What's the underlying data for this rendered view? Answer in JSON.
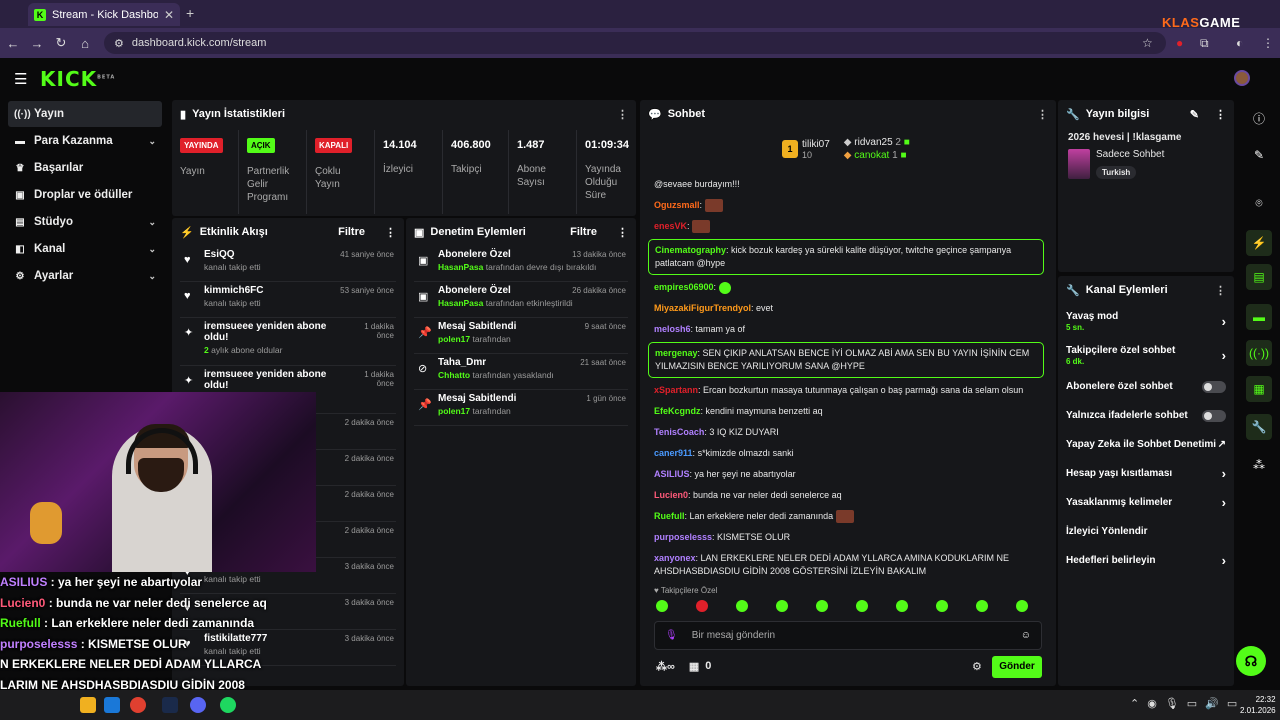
{
  "browser": {
    "tab_title": "Stream - Kick Dashboard",
    "url": "dashboard.kick.com/stream",
    "brand_left": "KLAS",
    "brand_right": "GAME"
  },
  "header": {
    "logo": "KICK",
    "logo_sup": "BETA"
  },
  "sidebar": {
    "items": [
      {
        "label": "Yayın",
        "icon": "stream-icon",
        "active": true
      },
      {
        "label": "Para Kazanma",
        "icon": "money-icon",
        "expand": true
      },
      {
        "label": "Başarılar",
        "icon": "trophy-icon"
      },
      {
        "label": "Droplar ve ödüller",
        "icon": "gift-icon"
      },
      {
        "label": "Stüdyo",
        "icon": "studio-icon",
        "expand": true
      },
      {
        "label": "Kanal",
        "icon": "channel-icon",
        "expand": true
      },
      {
        "label": "Ayarlar",
        "icon": "gear-icon",
        "expand": true
      }
    ]
  },
  "stats": {
    "title": "Yayın İstatistikleri",
    "cols": [
      {
        "badge": "YAYINDA",
        "badge_color": "#e0202a",
        "label": "Yayın"
      },
      {
        "badge": "AÇIK",
        "badge_color": "#53fc18",
        "label": "Partnerlik Gelir Programı"
      },
      {
        "badge": "KAPALI",
        "badge_color": "#e0202a",
        "label": "Çoklu Yayın"
      },
      {
        "value": "14.104",
        "label": "İzleyici"
      },
      {
        "value": "406.800",
        "label": "Takipçi"
      },
      {
        "value": "1.487",
        "label": "Abone Sayısı"
      },
      {
        "value": "01:09:34",
        "label": "Yayında Olduğu Süre"
      }
    ]
  },
  "activity": {
    "title": "Etkinlik Akışı",
    "filter": "Filtre",
    "items": [
      {
        "name": "EsiQQ",
        "sub": "kanalı takip etti",
        "time": "41 saniye önce",
        "icon": "heart-icon"
      },
      {
        "name": "kimmich6FC",
        "sub": "kanalı takip etti",
        "time": "53 saniye önce",
        "icon": "heart-icon"
      },
      {
        "name": "iremsueee yeniden abone oldu!",
        "sub_green": "2",
        "sub": "aylık abone oldular",
        "time": "1 dakika önce",
        "icon": "sparkle-icon"
      },
      {
        "name": "iremsueee yeniden abone oldu!",
        "sub": "",
        "time": "1 dakika önce",
        "icon": "sparkle-icon"
      },
      {
        "name": "",
        "sub": "",
        "time": "2 dakika önce",
        "icon": ""
      },
      {
        "name": "",
        "sub": "",
        "time": "2 dakika önce",
        "icon": ""
      },
      {
        "name": "",
        "sub": "",
        "time": "2 dakika önce",
        "icon": ""
      },
      {
        "name": "",
        "sub": "",
        "time": "2 dakika önce",
        "icon": ""
      },
      {
        "name": "memofirarda",
        "sub": "kanalı takip etti",
        "time": "3 dakika önce",
        "icon": "heart-icon"
      },
      {
        "name": "",
        "sub": "",
        "time": "3 dakika önce",
        "icon": "heart-icon"
      },
      {
        "name": "fistikilatte777",
        "sub": "kanalı takip etti",
        "time": "3 dakika önce",
        "icon": "heart-icon"
      }
    ]
  },
  "moderation": {
    "title": "Denetim Eylemleri",
    "filter": "Filtre",
    "items": [
      {
        "name": "Abonelere Özel",
        "green": "HasanPasa",
        "sub": "tarafından devre dışı bırakıldı",
        "time": "13 dakika önce",
        "icon": "gift-icon"
      },
      {
        "name": "Abonelere Özel",
        "green": "HasanPasa",
        "sub": "tarafından etkinleştirildi",
        "time": "26 dakika önce",
        "icon": "gift-icon"
      },
      {
        "name": "Mesaj Sabitlendi",
        "green": "polen17",
        "sub": "tarafından",
        "time": "9 saat önce",
        "icon": "pin-icon"
      },
      {
        "name": "Taha_Dmr",
        "green": "Chhatto",
        "sub": "tarafından yasaklandı",
        "time": "21 saat önce",
        "icon": "ban-icon"
      },
      {
        "name": "Mesaj Sabitlendi",
        "green": "polen17",
        "sub": "tarafından",
        "time": "1 gün önce",
        "icon": "pin-icon"
      }
    ]
  },
  "chat": {
    "title": "Sohbet",
    "top": [
      {
        "rank": "1",
        "name": "tiliki07",
        "count": "10"
      },
      {
        "name": "ridvan25",
        "count": "2"
      },
      {
        "name": "canokat",
        "count": "1"
      }
    ],
    "messages": [
      {
        "user": "",
        "color": "#53fc18",
        "text": "@sevaee burdayım!!!",
        "emote": false
      },
      {
        "user": "Oguzsmall",
        "color": "#ff6a1a",
        "text": "",
        "emote": true
      },
      {
        "user": "enesVK",
        "color": "#e0202a",
        "text": "",
        "emote": true
      },
      {
        "user": "Cinematography",
        "color": "#53fc18",
        "text": "kick bozuk kardeş ya sürekli kalite düşüyor, twitche geçince şampanya patlatcam @hype",
        "hl": true
      },
      {
        "user": "empires06900",
        "color": "#53fc18",
        "text": "",
        "gemote": true
      },
      {
        "user": "MiyazakiFigurTrendyol",
        "color": "#ff9a1a",
        "text": "evet"
      },
      {
        "user": "melosh6",
        "color": "#b080ff",
        "text": "tamam ya of"
      },
      {
        "user": "mergenay",
        "color": "#53fc18",
        "text": "SEN ÇIKIP ANLATSAN BENCE İYİ OLMAZ ABİ AMA SEN BU YAYIN İŞİNİN CEM YILMAZISIN BENCE YARILIYORUM SANA @HYPE",
        "hl": true
      },
      {
        "user": "xSpartann",
        "color": "#e0202a",
        "text": "Ercan bozkurtun masaya tutunmaya çalışan o baş parmağı sana da selam olsun"
      },
      {
        "user": "EfeKcgndz",
        "color": "#53fc18",
        "text": "kendini maymuna benzetti aq"
      },
      {
        "user": "TenisCoach",
        "color": "#b080ff",
        "text": "3 IQ KIZ DUYARI"
      },
      {
        "user": "caner911",
        "color": "#4a9aff",
        "text": "s*kimizde olmazdı sanki"
      },
      {
        "user": "ASILIUS",
        "color": "#b080ff",
        "text": "ya her şeyi ne abartıyolar"
      },
      {
        "user": "Lucien0",
        "color": "#ff5a7a",
        "text": "bunda ne var neler dedi senelerce aq"
      },
      {
        "user": "Ruefull",
        "color": "#53fc18",
        "text": "Lan erkeklere neler dedi zamanında",
        "emote": true
      },
      {
        "user": "purposelesss",
        "color": "#b080ff",
        "text": "KISMETSE OLUR"
      },
      {
        "user": "xanyonex",
        "color": "#b080ff",
        "text": "LAN ERKEKLERE NELER DEDİ ADAM YLLARCA AMINA KODUKLARIM NE AHSDHASBDIASDIU GİDİN 2008 GÖSTERSİNİ İZLEYİN BAKALIM"
      }
    ],
    "followers_only": "Takipçilere Özel",
    "input_placeholder": "Bir mesaj gönderin",
    "send": "Gönder",
    "points": "0"
  },
  "info": {
    "title": "Yayın bilgisi",
    "stream_title": "2026 hevesi | !klasgame",
    "category": "Sadece Sohbet",
    "tag": "Turkish"
  },
  "actions": {
    "title": "Kanal Eylemleri",
    "items": [
      {
        "label": "Yavaş mod",
        "sub": "5 sn.",
        "type": "chevron"
      },
      {
        "label": "Takipçilere özel sohbet",
        "sub": "6 dk.",
        "type": "chevron"
      },
      {
        "label": "Abonelere özel sohbet",
        "type": "toggle"
      },
      {
        "label": "Yalnızca ifadelerle sohbet",
        "type": "toggle"
      },
      {
        "label": "Yapay Zeka ile Sohbet Denetimi",
        "type": "external"
      },
      {
        "label": "Hesap yaşı kısıtlaması",
        "type": "chevron"
      },
      {
        "label": "Yasaklanmış kelimeler",
        "type": "chevron"
      },
      {
        "label": "İzleyici Yönlendir",
        "type": "none"
      },
      {
        "label": "Hedefleri belirleyin",
        "type": "chevron"
      }
    ]
  },
  "overlay": {
    "lines": [
      {
        "user": "ASILIUS",
        "color": "#c080ff",
        "text": " : ya her şeyi ne abartıyolar"
      },
      {
        "user": "Lucien0",
        "color": "#ff5a7a",
        "text": " : bunda ne var neler dedi senelerce aq"
      },
      {
        "user": "Ruefull",
        "color": "#53fc18",
        "text": " : Lan erkeklere neler dedi zamanında"
      },
      {
        "user": "purposelesss",
        "color": "#c080ff",
        "text": " : KISMETSE OLUR"
      },
      {
        "user": "",
        "color": "#fff",
        "text": "N ERKEKLERE NELER DEDİ ADAM YLLARCA"
      },
      {
        "user": "",
        "color": "#fff",
        "text": "LARIM NE AHSDHASBDIASDIU GİDİN 2008"
      },
      {
        "user": "",
        "color": "#fff",
        "text": "ZLEYİN BAKALIM"
      }
    ]
  },
  "taskbar": {
    "time": "22:32",
    "date": "2.01.2026"
  }
}
